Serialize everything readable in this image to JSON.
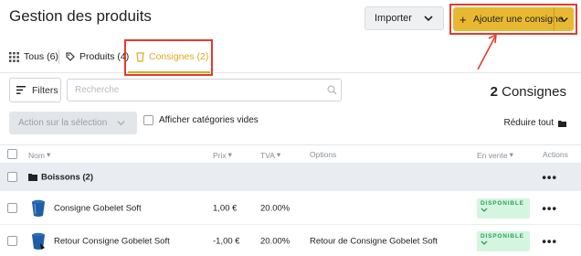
{
  "header": {
    "title": "Gestion des produits",
    "import_label": "Importer",
    "add_plus": "+",
    "add_label": "Ajouter une consigne"
  },
  "tabs": [
    {
      "label": "Tous (6)",
      "icon": "grid-icon"
    },
    {
      "label": "Produits (4)",
      "icon": "tag-icon"
    },
    {
      "label": "Consignes (2)",
      "icon": "cup-icon",
      "active": true
    }
  ],
  "toolbar": {
    "filters_label": "Filters",
    "search_placeholder": "Recherche",
    "count_number": "2",
    "count_label": "Consignes",
    "bulk_action_label": "Action sur la sélection",
    "empty_categories_label": "Afficher catégories vides",
    "collapse_all_label": "Réduire tout"
  },
  "table": {
    "columns": {
      "name": "Nom",
      "price": "Prix",
      "vat": "TVA",
      "options": "Options",
      "on_sale": "En vente",
      "actions": "Actions"
    },
    "group": {
      "label": "Boissons (2)"
    },
    "rows": [
      {
        "name": "Consigne Gobelet Soft",
        "price": "1,00 €",
        "vat": "20.00%",
        "options": "",
        "status": "DISPONIBLE"
      },
      {
        "name": "Retour Consigne Gobelet Soft",
        "price": "-1,00 €",
        "vat": "20.00%",
        "options": "Retour de Consigne Gobelet Soft",
        "status": "DISPONIBLE"
      }
    ],
    "row_menu": "•••"
  },
  "colors": {
    "accent": "#e8b832",
    "annotation": "#e23c2c",
    "available": "#2aa35a",
    "group_bg": "#e9ecf1"
  }
}
